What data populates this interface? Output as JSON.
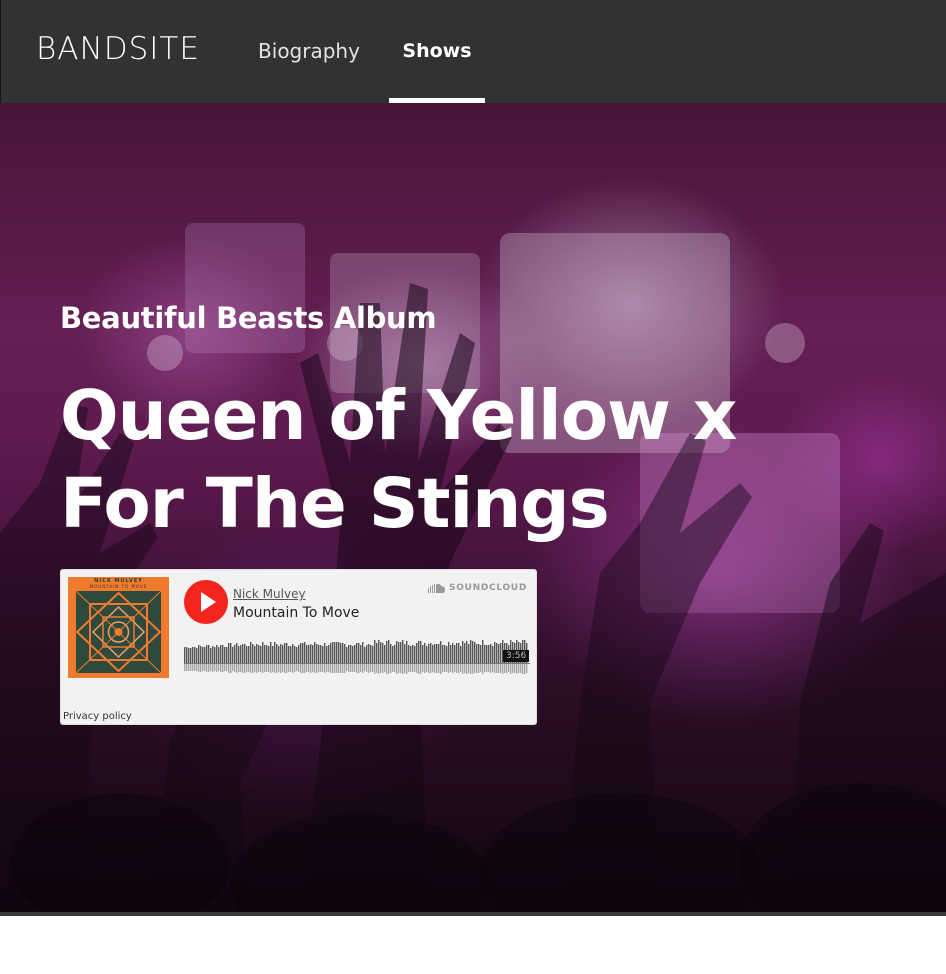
{
  "header": {
    "logo": "BANDSITE",
    "nav": [
      {
        "label": "Biography",
        "active": false
      },
      {
        "label": "Shows",
        "active": true
      }
    ]
  },
  "hero": {
    "album_label": "Beautiful Beasts Album",
    "title_line1": "Queen of Yellow x",
    "title_line2": "For The Stings"
  },
  "player": {
    "artwork_artist": "NICK MULVEY",
    "artwork_title": "MOUNTAIN TO MOVE",
    "artist": "Nick Mulvey",
    "track": "Mountain To Move",
    "brand": "SOUNDCLOUD",
    "duration": "3:56",
    "privacy": "Privacy policy",
    "play_color": "#f3251c"
  },
  "colors": {
    "header_bg": "#323232",
    "hero_tint": "#6b2159",
    "accent_text": "#ffffff"
  },
  "icons": [
    "play-icon",
    "soundcloud-icon"
  ]
}
